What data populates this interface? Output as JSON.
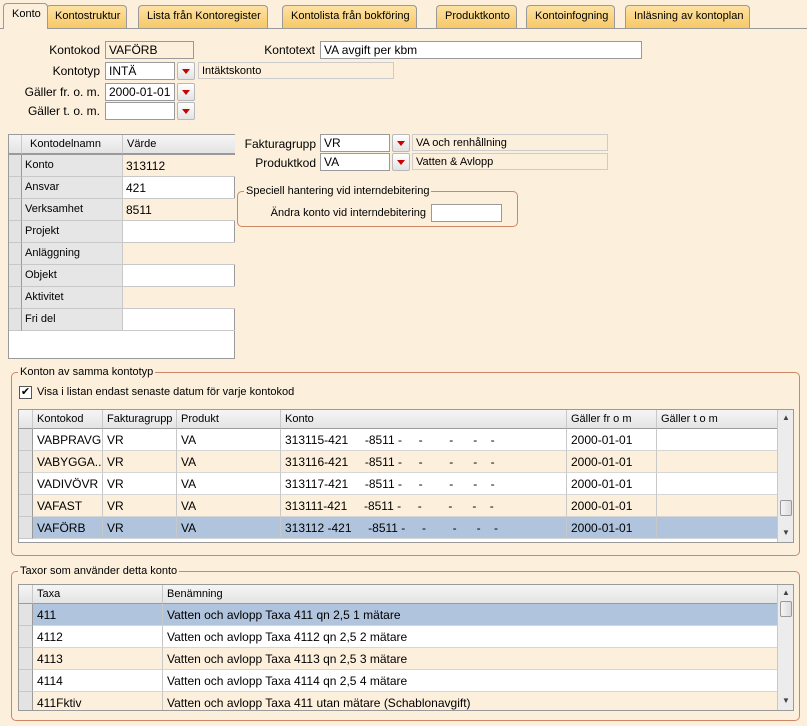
{
  "tabs": [
    "Konto",
    "Kontostruktur",
    "Lista från Kontoregister",
    "Kontolista från bokföring",
    "Produktkonto",
    "Kontoinfogning",
    "Inläsning av kontoplan"
  ],
  "form": {
    "kontokod_label": "Kontokod",
    "kontokod": "VAFÖRB",
    "kontotext_label": "Kontotext",
    "kontotext": "VA avgift per kbm",
    "kontotyp_label": "Kontotyp",
    "kontotyp": "INTÄ",
    "kontotyp_info": "Intäktskonto",
    "galler_from_label": "Gäller fr. o. m.",
    "galler_from": "2000-01-01",
    "galler_tom_label": "Gäller t. o. m.",
    "galler_tom": "",
    "fakturagrupp_label": "Fakturagrupp",
    "fakturagrupp": "VR",
    "fakturagrupp_info": "VA och renhållning",
    "produktkod_label": "Produktkod",
    "produktkod": "VA",
    "produktkod_info": "Vatten & Avlopp"
  },
  "special": {
    "legend": "Speciell hantering vid interndebitering",
    "label": "Ändra konto vid interndebitering",
    "value": ""
  },
  "kontodelar": {
    "headers": [
      "Kontodelnamn",
      "Värde"
    ],
    "rows": [
      {
        "name": "Konto",
        "value": "313112"
      },
      {
        "name": "Ansvar",
        "value": "421"
      },
      {
        "name": "Verksamhet",
        "value": "8511"
      },
      {
        "name": "Projekt",
        "value": ""
      },
      {
        "name": "Anläggning",
        "value": ""
      },
      {
        "name": "Objekt",
        "value": ""
      },
      {
        "name": "Aktivitet",
        "value": ""
      },
      {
        "name": "Fri del",
        "value": ""
      }
    ]
  },
  "samma": {
    "legend": "Konton av samma kontotyp",
    "checkbox_label": "Visa i listan endast senaste datum för varje kontokod",
    "headers": [
      "Kontokod",
      "Fakturagrupp",
      "Produkt",
      "Konto",
      "Gäller fr o m",
      "Gäller t o m"
    ],
    "rows": [
      [
        "VABPRAVG",
        "VR",
        "VA",
        "313115-421     -8511 -     -        -      -    -",
        "2000-01-01",
        ""
      ],
      [
        "VABYGGA...",
        "VR",
        "VA",
        "313116-421     -8511 -     -        -      -    -",
        "2000-01-01",
        ""
      ],
      [
        "VADIVÖVR",
        "VR",
        "VA",
        "313117-421     -8511 -     -        -      -    -",
        "2000-01-01",
        ""
      ],
      [
        "VAFAST",
        "VR",
        "VA",
        "313111-421     -8511 -     -        -      -    -",
        "2000-01-01",
        ""
      ],
      [
        "VAFÖRB",
        "VR",
        "VA",
        "313112 -421     -8511 -     -        -      -    -",
        "2000-01-01",
        ""
      ]
    ]
  },
  "taxor": {
    "legend": "Taxor som använder detta konto",
    "headers": [
      "Taxa",
      "Benämning"
    ],
    "rows": [
      [
        "411",
        "Vatten och avlopp Taxa 411 qn 2,5 1 mätare"
      ],
      [
        "4112",
        "Vatten och avlopp Taxa 4112 qn 2,5 2 mätare"
      ],
      [
        "4113",
        "Vatten och avlopp Taxa 4113 qn 2,5 3 mätare"
      ],
      [
        "4114",
        "Vatten och avlopp Taxa 4114 qn 2,5 4 mätare"
      ],
      [
        "411Fktiv",
        "Vatten och avlopp Taxa 411 utan mätare (Schablonavgift)"
      ]
    ]
  }
}
